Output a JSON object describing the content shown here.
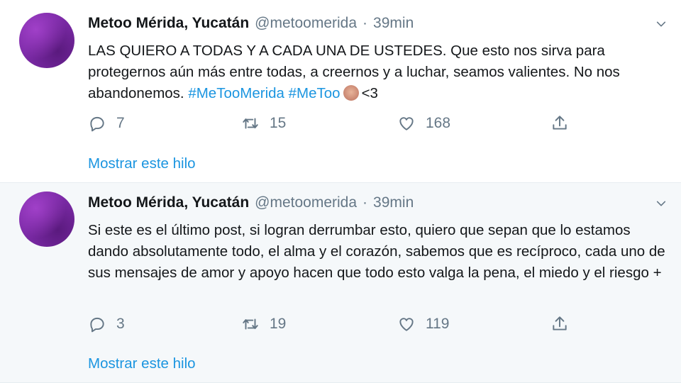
{
  "tweets": [
    {
      "author_name": "Metoo Mérida, Yucatán",
      "handle": "@metoomerida",
      "separator": "·",
      "time": "39min",
      "text_main": "LAS QUIERO A TODAS Y A CADA UNA DE USTEDES. Que esto nos sirva para protegernos aún más entre todas, a creernos y a luchar, seamos valientes. No nos abandonemos. ",
      "hashtag_1": "#MeTooMerida",
      "hashtag_2": "#MeToo",
      "text_end": "<3",
      "replies": "7",
      "retweets": "15",
      "likes": "168",
      "show_thread": "Mostrar este hilo"
    },
    {
      "author_name": "Metoo Mérida, Yucatán",
      "handle": "@metoomerida",
      "separator": "·",
      "time": "39min",
      "text_main": "Si este es el último post, si logran derrumbar esto, quiero que sepan que lo estamos dando absolutamente todo, el alma y el corazón, sabemos que es recíproco, cada uno de sus mensajes de amor y apoyo hacen que todo esto valga la pena, el miedo y el riesgo +",
      "replies": "3",
      "retweets": "19",
      "likes": "119",
      "show_thread": "Mostrar este hilo"
    }
  ],
  "icons": {
    "reply": "reply-icon",
    "retweet": "retweet-icon",
    "like": "heart-icon",
    "share": "share-icon",
    "caret": "chevron-down-icon"
  },
  "colors": {
    "link": "#1b95e0",
    "secondary": "#657786",
    "avatar": "#7b2aa6"
  }
}
